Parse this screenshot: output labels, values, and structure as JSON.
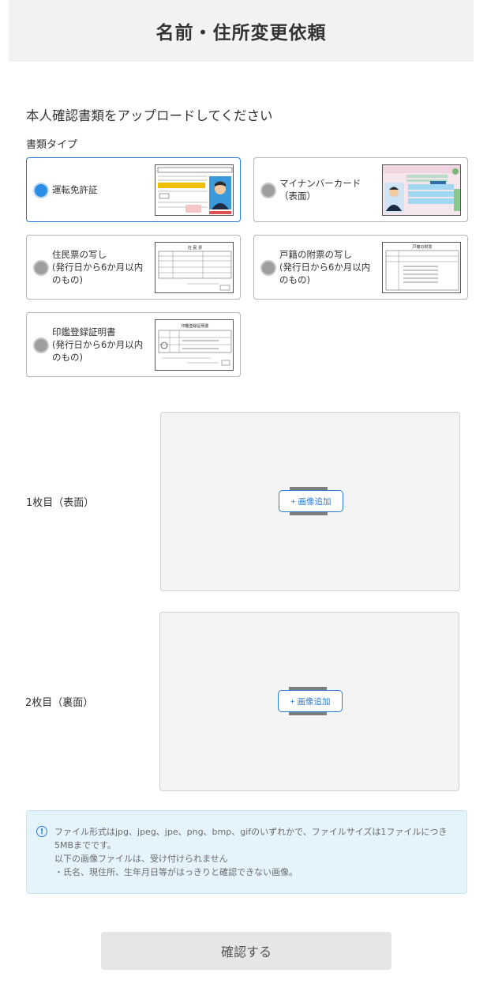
{
  "header": {
    "title": "名前・住所変更依頼"
  },
  "section": {
    "title": "本人確認書類をアップロードしてください",
    "doc_type_label": "書類タイプ"
  },
  "options": [
    {
      "label": "運転免許証",
      "selected": true,
      "thumb": "drivers-license"
    },
    {
      "label": "マイナンバーカード（表面）",
      "selected": false,
      "thumb": "mynumber-card"
    },
    {
      "label": "住民票の写し\n(発行日から6か月以内のもの)",
      "selected": false,
      "thumb": "residence-certificate"
    },
    {
      "label": "戸籍の附票の写し\n(発行日から6か月以内のもの)",
      "selected": false,
      "thumb": "family-register-attachment"
    },
    {
      "label": "印鑑登録証明書\n(発行日から6か月以内のもの)",
      "selected": false,
      "thumb": "seal-certificate"
    }
  ],
  "thumb_text": {
    "residence_title": "住 民 票",
    "family_title": "戸籍の附票",
    "seal_title": "印鑑登録証明書"
  },
  "uploads": [
    {
      "label": "1枚目（表面）",
      "button_label": "+ 画像追加"
    },
    {
      "label": "2枚目（裏面）",
      "button_label": "+ 画像追加"
    }
  ],
  "notice": {
    "icon": "info-icon",
    "lines": [
      "ファイル形式はjpg、jpeg、jpe、png、bmp、gifのいずれかで、ファイルサイズは1ファイルにつき5MBまでです。",
      "以下の画像ファイルは、受け付けられません",
      "・氏名、現住所、生年月日等がはっきりと確認できない画像。"
    ]
  },
  "confirm_button": {
    "label": "確認する"
  },
  "colors": {
    "accent": "#2b7bd6",
    "header_bg": "#f2f2f2",
    "notice_bg": "#e5f3fd",
    "button_bg": "#e6e6e6"
  }
}
